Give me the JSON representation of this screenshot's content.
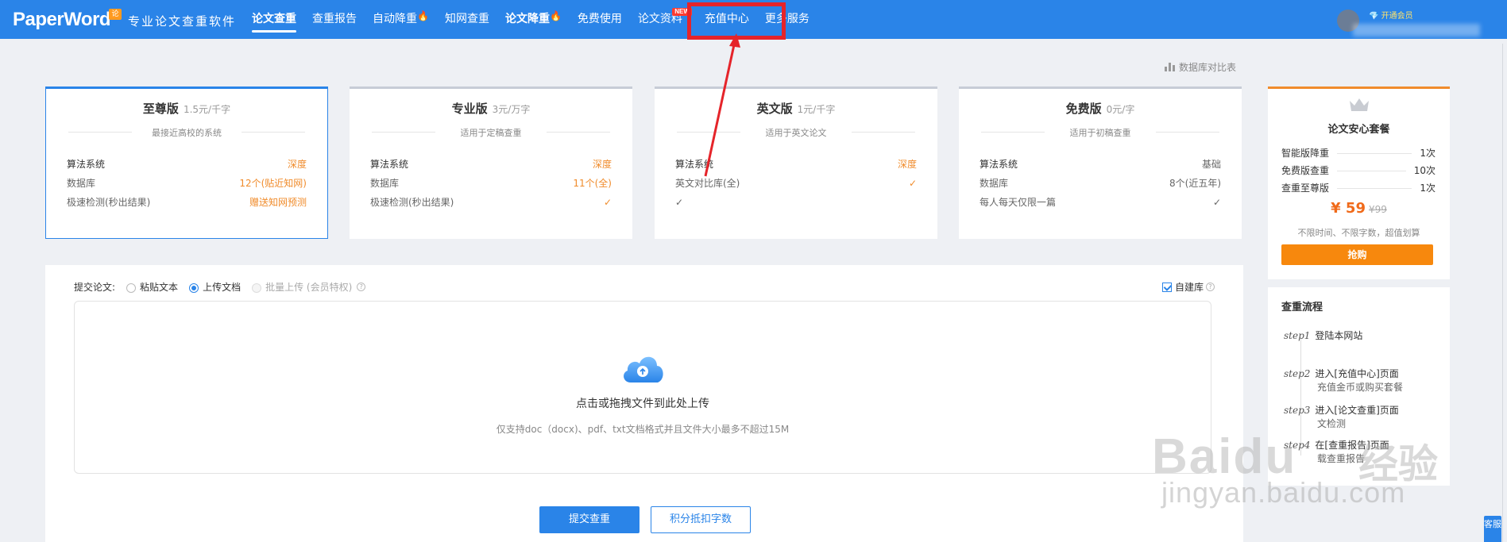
{
  "header": {
    "logo": "PaperWord",
    "logo_badge": "论",
    "slogan": "专业论文查重软件",
    "nav": [
      {
        "label": "论文查重",
        "active": true
      },
      {
        "label": "查重报告"
      },
      {
        "label": "自动降重",
        "hot": true
      },
      {
        "label": "知网查重"
      },
      {
        "label": "论文降重",
        "hot": true
      },
      {
        "label": "免费使用"
      },
      {
        "label": "论文资料",
        "badge": "NEW"
      },
      {
        "label": "充值中心",
        "highlighted": true
      },
      {
        "label": "更多服务"
      }
    ],
    "user": {
      "vip_label": "开通会员"
    }
  },
  "db_compare_link": "数据库对比表",
  "plans": [
    {
      "name": "至尊版",
      "price": "1.5元/千字",
      "subtitle": "最接近高校的系统",
      "rows": [
        {
          "label": "算法系统",
          "value": "深度"
        },
        {
          "label": "数据库",
          "value": "12个(贴近知网)"
        },
        {
          "label": "极速检测(秒出结果)",
          "value": "赠送知网预测"
        }
      ]
    },
    {
      "name": "专业版",
      "price": "3元/万字",
      "subtitle": "适用于定稿查重",
      "rows": [
        {
          "label": "算法系统",
          "value": "深度"
        },
        {
          "label": "数据库",
          "value": "11个(全)"
        },
        {
          "label": "极速检测(秒出结果)",
          "value": "✓"
        }
      ]
    },
    {
      "name": "英文版",
      "price": "1元/千字",
      "subtitle": "适用于英文论文",
      "rows": [
        {
          "label": "算法系统",
          "value": "深度"
        },
        {
          "label": "英文对比库(全)",
          "value": "✓"
        },
        {
          "label": "✓",
          "value": ""
        }
      ]
    },
    {
      "name": "免费版",
      "price": "0元/字",
      "subtitle": "适用于初稿查重",
      "rows": [
        {
          "label": "算法系统",
          "value": "基础"
        },
        {
          "label": "数据库",
          "value": "8个(近五年)"
        },
        {
          "label": "每人每天仅限一篇",
          "value": "✓"
        }
      ]
    }
  ],
  "promo": {
    "title": "论文安心套餐",
    "rows": [
      {
        "label": "智能版降重",
        "count": "1次"
      },
      {
        "label": "免费版查重",
        "count": "10次"
      },
      {
        "label": "查重至尊版",
        "count": "1次"
      }
    ],
    "price": "¥ 59",
    "old_price": "¥99",
    "note": "不限时间、不限字数，超值划算",
    "button": "抢购"
  },
  "process": {
    "title": "查重流程",
    "steps": [
      {
        "tag": "step1",
        "text": "登陆本网站",
        "text2": ""
      },
      {
        "tag": "step2",
        "text": "进入[充值中心]页面",
        "text2": "充值金币或购买套餐"
      },
      {
        "tag": "step3",
        "text": "进入[论文查重]页面",
        "text2": "文检测"
      },
      {
        "tag": "step4",
        "text": "在[查重报告]页面",
        "text2": "载查重报告"
      }
    ]
  },
  "submit": {
    "label": "提交论文:",
    "options": [
      {
        "label": "粘贴文本",
        "checked": false
      },
      {
        "label": "上传文档",
        "checked": true
      },
      {
        "label": "批量上传 (会员特权)",
        "disabled": true
      }
    ],
    "self_db": "自建库",
    "upload_text": "点击或拖拽文件到此处上传",
    "upload_hint": "仅支持doc（docx)、pdf、txt文档格式并且文件大小最多不超过15M",
    "submit_button": "提交查重",
    "points_button": "积分抵扣字数"
  },
  "service_tab": "客服",
  "watermark": {
    "brand": "Baidu",
    "cn": "经验",
    "url": "jingyan.baidu.com"
  },
  "colors": {
    "primary": "#2a84e8",
    "accent": "#f08c2c",
    "highlight": "#e5242a"
  }
}
